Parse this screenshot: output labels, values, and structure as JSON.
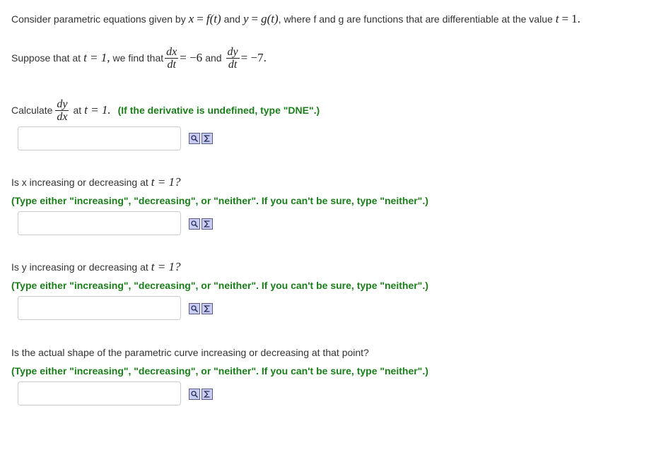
{
  "intro": {
    "t1": "Consider parametric equations given by",
    "x_var": "x",
    "eq": "=",
    "f_of_t": "f(t)",
    "and": "and",
    "y_var": "y",
    "g_of_t": "g(t)",
    "t2": ", where f and g are functions that are differentiable at the value",
    "t_var": "t",
    "one_period": "1."
  },
  "given": {
    "t1": "Suppose that at",
    "t_eq": "t = 1,",
    "t2": "we find that",
    "dx_num": "dx",
    "dx_den": "dt",
    "dx_val": "= −6",
    "and": "and",
    "dy_num": "dy",
    "dy_den": "dt",
    "dy_val": "= −7."
  },
  "questions": [
    {
      "pre": "Calculate",
      "frac_num": "dy",
      "frac_den": "dx",
      "post": "at",
      "t_expr": "t = 1.",
      "hint": "(If the derivative is undefined, type \"DNE\".)",
      "answer": ""
    },
    {
      "text": "Is x increasing or decreasing at",
      "t_expr": "t = 1?",
      "hint": "(Type either \"increasing\", \"decreasing\", or \"neither\".  If you can't be sure, type \"neither\".)",
      "answer": ""
    },
    {
      "text": "Is y increasing or decreasing at",
      "t_expr": "t = 1?",
      "hint": "(Type either \"increasing\", \"decreasing\", or \"neither\".  If you can't be sure, type \"neither\".)",
      "answer": ""
    },
    {
      "text": "Is the actual shape of the parametric curve increasing or decreasing at that point?",
      "hint": "(Type either \"increasing\", \"decreasing\", or \"neither\".  If you can't be sure, type \"neither\".)",
      "answer": ""
    }
  ],
  "tools": {
    "preview_icon": "preview-icon",
    "equation_editor_icon": "sigma-equation-icon"
  },
  "colors": {
    "hint_green": "#1a7f1a",
    "text": "#333333",
    "tool_fill": "#c7cdf0"
  }
}
